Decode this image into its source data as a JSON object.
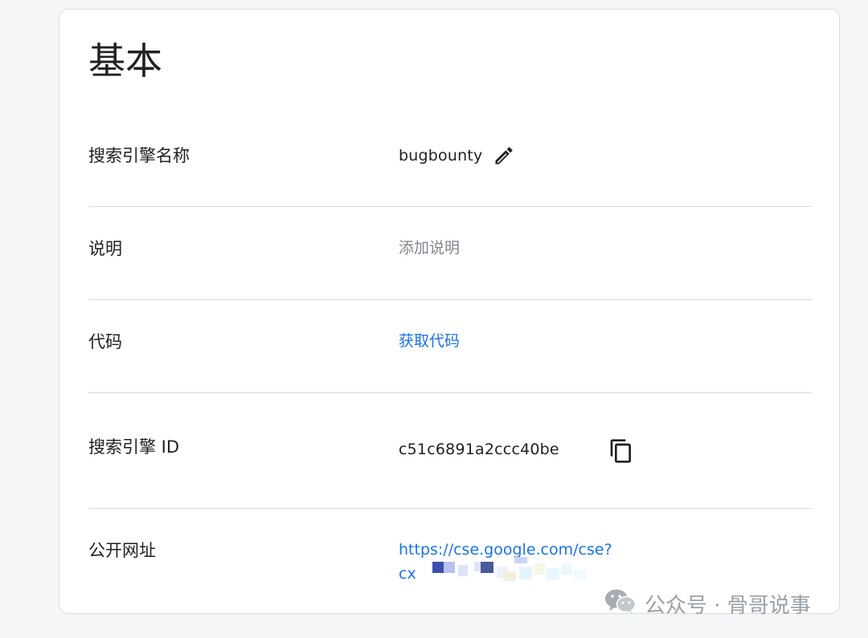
{
  "section": {
    "title": "基本"
  },
  "rows": {
    "engine_name": {
      "label": "搜索引擎名称",
      "value": "bugbounty",
      "edit_icon": "pencil-icon"
    },
    "description": {
      "label": "说明",
      "placeholder": "添加说明"
    },
    "code": {
      "label": "代码",
      "link_text": "获取代码"
    },
    "engine_id": {
      "label": "搜索引擎 ID",
      "value": "c51c6891a2ccc40be",
      "copy_icon": "copy-icon"
    },
    "public_url": {
      "label": "公开网址",
      "line1": "https://cse.google.com/cse?",
      "line2_prefix": "cx"
    }
  },
  "watermark": {
    "text": "公众号 · 骨哥说事",
    "icon": "wechat-icon"
  },
  "colors": {
    "link": "#1a73e8",
    "placeholder": "#80868b",
    "divider": "#dadce0"
  }
}
